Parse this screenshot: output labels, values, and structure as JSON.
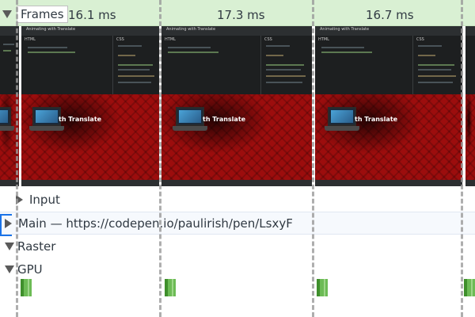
{
  "frames": {
    "label": "Frames",
    "times": [
      "16.1 ms",
      "17.3 ms",
      "16.7 ms"
    ]
  },
  "screenshot": {
    "tab_title": "Animating with Translate",
    "panes": [
      "HTML",
      "CSS"
    ],
    "stage_text": "th Translate"
  },
  "tracks": {
    "input": "Input",
    "main": "Main — https://codepen.io/paulirish/pen/LsxyF",
    "raster": "Raster",
    "gpu": "GPU"
  },
  "colors": {
    "frames_bg": "#d9f0d3",
    "gpu_block": "#6cbb55",
    "selection_blue": "#1a73e8",
    "stage_red": "#9c0d0d"
  }
}
